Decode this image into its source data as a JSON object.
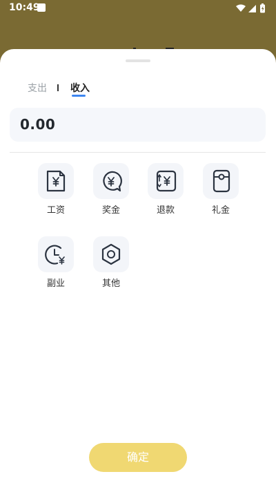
{
  "status_bar": {
    "time": "10:49",
    "icons": [
      "wifi-icon",
      "cell-signal-icon",
      "battery-charging-icon"
    ]
  },
  "colors": {
    "backdrop": "#7a6a33",
    "accent": "#3d86f0",
    "confirm": "#f0d872",
    "icon_stroke": "#2b3340"
  },
  "tabs": {
    "expense": "支出",
    "income": "收入",
    "active": "income"
  },
  "amount": {
    "value": "0.00"
  },
  "categories": [
    {
      "label": "工资",
      "icon": "salary-document-icon"
    },
    {
      "label": "奖金",
      "icon": "bonus-coin-bubble-icon"
    },
    {
      "label": "退款",
      "icon": "refund-icon"
    },
    {
      "label": "礼金",
      "icon": "gift-money-icon"
    },
    {
      "label": "副业",
      "icon": "side-business-clock-icon"
    },
    {
      "label": "其他",
      "icon": "other-hexagon-icon"
    }
  ],
  "confirm_label": "确定"
}
